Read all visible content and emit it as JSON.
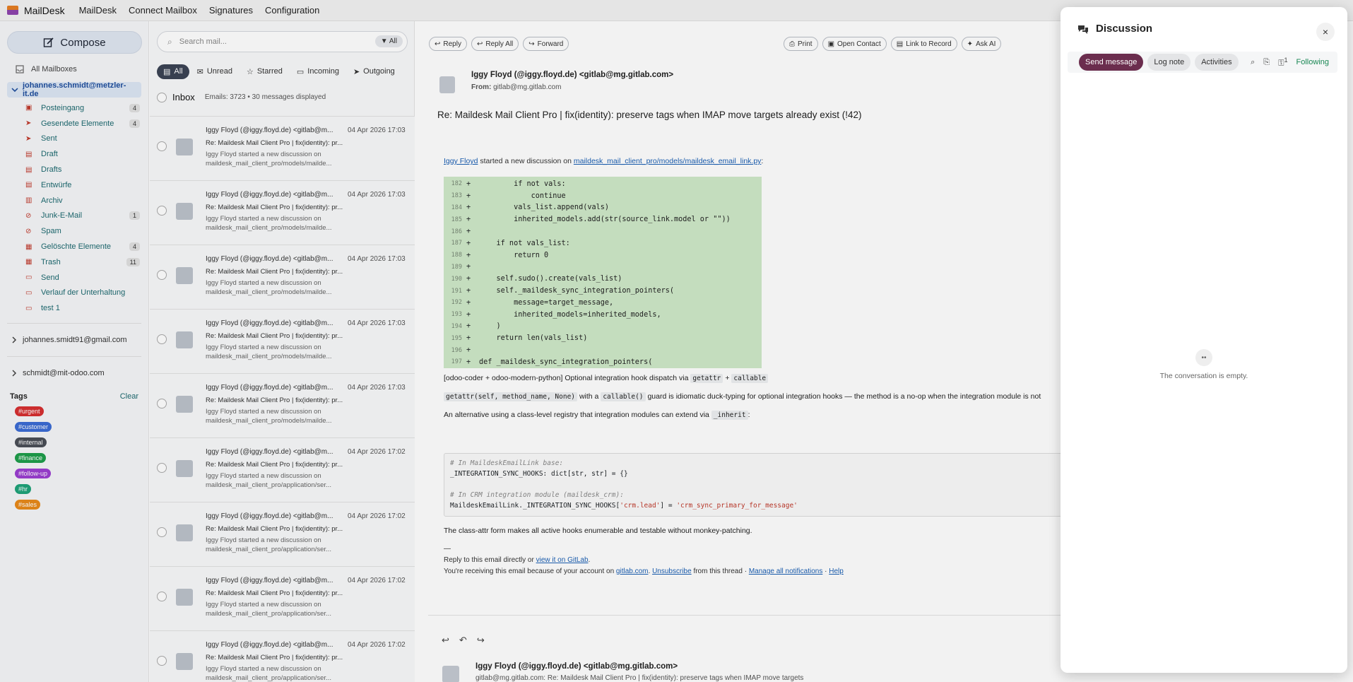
{
  "topbar": {
    "app_name": "MailDesk",
    "menu": [
      "MailDesk",
      "Connect Mailbox",
      "Signatures",
      "Configuration"
    ]
  },
  "sidebar": {
    "compose_label": "Compose",
    "all_mailboxes": "All Mailboxes",
    "active_account": "johannes.schmidt@metzler-it.de",
    "folders": [
      {
        "label": "Posteingang",
        "count": "4",
        "icon": "inbox-icon"
      },
      {
        "label": "Gesendete Elemente",
        "count": "4",
        "icon": "send-icon"
      },
      {
        "label": "Sent",
        "count": "",
        "icon": "send-icon"
      },
      {
        "label": "Draft",
        "count": "",
        "icon": "file-icon"
      },
      {
        "label": "Drafts",
        "count": "",
        "icon": "file-icon"
      },
      {
        "label": "Entwürfe",
        "count": "",
        "icon": "file-icon"
      },
      {
        "label": "Archiv",
        "count": "",
        "icon": "archive-icon"
      },
      {
        "label": "Junk-E-Mail",
        "count": "1",
        "icon": "ban-icon"
      },
      {
        "label": "Spam",
        "count": "",
        "icon": "ban-icon"
      },
      {
        "label": "Gelöschte Elemente",
        "count": "4",
        "icon": "trash-icon"
      },
      {
        "label": "Trash",
        "count": "11",
        "icon": "trash-icon"
      },
      {
        "label": "Send",
        "count": "",
        "icon": "folder-icon"
      },
      {
        "label": "Verlauf der Unterhaltung",
        "count": "",
        "icon": "folder-icon"
      },
      {
        "label": "test 1",
        "count": "",
        "icon": "folder-icon"
      }
    ],
    "other_accounts": [
      "johannes.smidt91@gmail.com",
      "schmidt@mit-odoo.com"
    ],
    "tags_title": "Tags",
    "tags_clear": "Clear",
    "tags": [
      {
        "label": "#urgent",
        "color": "#d63031"
      },
      {
        "label": "#customer",
        "color": "#3b6cd4"
      },
      {
        "label": "#internal",
        "color": "#4a4f57"
      },
      {
        "label": "#finance",
        "color": "#1e9e4a"
      },
      {
        "label": "#follow-up",
        "color": "#9b3fd1"
      },
      {
        "label": "#hr",
        "color": "#1fa37a"
      },
      {
        "label": "#sales",
        "color": "#e88a1a"
      }
    ]
  },
  "list": {
    "search_placeholder": "Search mail...",
    "search_filter": "All",
    "filters": [
      "All",
      "Unread",
      "Starred",
      "Incoming",
      "Outgoing"
    ],
    "inbox_title": "Inbox",
    "inbox_meta": "Emails: 3723 • 30 messages displayed",
    "messages": [
      {
        "from": "Iggy Floyd (@iggy.floyd.de) <gitlab@m...",
        "date": "04 Apr 2026 17:03",
        "subject": "Re: Maildesk Mail Client Pro | fix(identity): pr...",
        "preview1": "Iggy Floyd started a new discussion on",
        "preview2": "maildesk_mail_client_pro/models/mailde..."
      },
      {
        "from": "Iggy Floyd (@iggy.floyd.de) <gitlab@m...",
        "date": "04 Apr 2026 17:03",
        "subject": "Re: Maildesk Mail Client Pro | fix(identity): pr...",
        "preview1": "Iggy Floyd started a new discussion on",
        "preview2": "maildesk_mail_client_pro/models/mailde..."
      },
      {
        "from": "Iggy Floyd (@iggy.floyd.de) <gitlab@m...",
        "date": "04 Apr 2026 17:03",
        "subject": "Re: Maildesk Mail Client Pro | fix(identity): pr...",
        "preview1": "Iggy Floyd started a new discussion on",
        "preview2": "maildesk_mail_client_pro/models/mailde..."
      },
      {
        "from": "Iggy Floyd (@iggy.floyd.de) <gitlab@m...",
        "date": "04 Apr 2026 17:03",
        "subject": "Re: Maildesk Mail Client Pro | fix(identity): pr...",
        "preview1": "Iggy Floyd started a new discussion on",
        "preview2": "maildesk_mail_client_pro/models/mailde..."
      },
      {
        "from": "Iggy Floyd (@iggy.floyd.de) <gitlab@m...",
        "date": "04 Apr 2026 17:03",
        "subject": "Re: Maildesk Mail Client Pro | fix(identity): pr...",
        "preview1": "Iggy Floyd started a new discussion on",
        "preview2": "maildesk_mail_client_pro/models/mailde..."
      },
      {
        "from": "Iggy Floyd (@iggy.floyd.de) <gitlab@m...",
        "date": "04 Apr 2026 17:02",
        "subject": "Re: Maildesk Mail Client Pro | fix(identity): pr...",
        "preview1": "Iggy Floyd started a new discussion on",
        "preview2": "maildesk_mail_client_pro/application/ser..."
      },
      {
        "from": "Iggy Floyd (@iggy.floyd.de) <gitlab@m...",
        "date": "04 Apr 2026 17:02",
        "subject": "Re: Maildesk Mail Client Pro | fix(identity): pr...",
        "preview1": "Iggy Floyd started a new discussion on",
        "preview2": "maildesk_mail_client_pro/application/ser..."
      },
      {
        "from": "Iggy Floyd (@iggy.floyd.de) <gitlab@m...",
        "date": "04 Apr 2026 17:02",
        "subject": "Re: Maildesk Mail Client Pro | fix(identity): pr...",
        "preview1": "Iggy Floyd started a new discussion on",
        "preview2": "maildesk_mail_client_pro/application/ser..."
      },
      {
        "from": "Iggy Floyd (@iggy.floyd.de) <gitlab@m...",
        "date": "04 Apr 2026 17:02",
        "subject": "Re: Maildesk Mail Client Pro | fix(identity): pr...",
        "preview1": "Iggy Floyd started a new discussion on",
        "preview2": "maildesk_mail_client_pro/application/ser..."
      }
    ]
  },
  "reader": {
    "actions_left": [
      "Reply",
      "Reply All",
      "Forward"
    ],
    "actions_right": [
      "Print",
      "Open Contact",
      "Link to Record",
      "Ask AI"
    ],
    "sender": "Iggy Floyd (@iggy.floyd.de) <gitlab@mg.gitlab.com>",
    "from_label": "From:",
    "from_value": "gitlab@mg.gitlab.com",
    "subject": "Re: Maildesk Mail Client Pro | fix(identity): preserve tags when IMAP move targets already exist (!42)",
    "intro_author": "Iggy Floyd",
    "intro_text": "started a new discussion on",
    "intro_file": "maildesk_mail_client_pro/models/maildesk_email_link.py",
    "code_lines": [
      {
        "ln": "182",
        "txt": "        if not vals:"
      },
      {
        "ln": "183",
        "txt": "            continue"
      },
      {
        "ln": "184",
        "txt": "        vals_list.append(vals)"
      },
      {
        "ln": "185",
        "txt": "        inherited_models.add(str(source_link.model or \"\"))"
      },
      {
        "ln": "186",
        "txt": ""
      },
      {
        "ln": "187",
        "txt": "    if not vals_list:"
      },
      {
        "ln": "188",
        "txt": "        return 0"
      },
      {
        "ln": "189",
        "txt": ""
      },
      {
        "ln": "190",
        "txt": "    self.sudo().create(vals_list)"
      },
      {
        "ln": "191",
        "txt": "    self._maildesk_sync_integration_pointers("
      },
      {
        "ln": "192",
        "txt": "        message=target_message,"
      },
      {
        "ln": "193",
        "txt": "        inherited_models=inherited_models,"
      },
      {
        "ln": "194",
        "txt": "    )"
      },
      {
        "ln": "195",
        "txt": "    return len(vals_list)"
      },
      {
        "ln": "196",
        "txt": ""
      },
      {
        "ln": "197",
        "txt": "def _maildesk_sync_integration_pointers("
      }
    ],
    "para1_text": "[odoo-coder + odoo-modern-python] Optional integration hook dispatch via",
    "para1_code1": "getattr",
    "para1_plus": "+",
    "para1_code2": "callable",
    "para2_code1": "getattr(self, method_name, None)",
    "para2_mid": "with a",
    "para2_code2": "callable()",
    "para2_rest": "guard is idiomatic duck-typing for optional integration hooks — the method is a no-op when the integration module is not",
    "para3_text": "An alternative using a class-level registry that integration modules can extend via",
    "para3_code": "_inherit",
    "para3_end": ":",
    "codeblock": {
      "l1": "# In MaildeskEmailLink base:",
      "l2": "_INTEGRATION_SYNC_HOOKS: dict[str, str] = {}",
      "l3": "# In CRM integration module (maildesk_crm):",
      "l4a": "MaildeskEmailLink._INTEGRATION_SYNC_HOOKS[",
      "l4b": "'crm.lead'",
      "l4c": "] = ",
      "l4d": "'crm_sync_primary_for_message'"
    },
    "para4_text": "The class-attr form makes all active hooks enumerable and testable without monkey-patching.",
    "footer_dash": "—",
    "footer1_text": "Reply to this email directly or",
    "footer1_link": "view it on GitLab",
    "footer1_end": ".",
    "footer2_text": "You're receiving this email because of your account on",
    "footer2_link1": "gitlab.com",
    "footer2_dot": ".",
    "footer2_link2": "Unsubscribe",
    "footer2_mid": "from this thread ·",
    "footer2_link3": "Manage all notifications",
    "footer2_sep": "·",
    "footer2_link4": "Help",
    "bottom_sender": "Iggy Floyd (@iggy.floyd.de) <gitlab@mg.gitlab.com>",
    "bottom_from": "gitlab@mg.gitlab.com: Re: Maildesk Mail Client Pro | fix(identity): preserve tags when IMAP move targets"
  },
  "discussion": {
    "title": "Discussion",
    "send_message": "Send message",
    "log_note": "Log note",
    "activities": "Activities",
    "followers_count": "1",
    "following": "Following",
    "empty_text": "The conversation is empty."
  }
}
